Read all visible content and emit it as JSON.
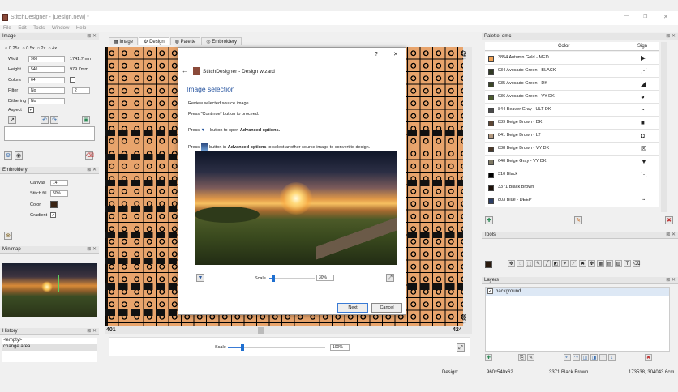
{
  "window": {
    "title": "StitchDesigner - [Design.new] *",
    "minimize": "—",
    "maximize": "❐",
    "close": "✕"
  },
  "menu": [
    "File",
    "Edit",
    "Tools",
    "Window",
    "Help"
  ],
  "image_panel": {
    "title": "Image",
    "zoom_options": [
      "0.25x",
      "0.5x",
      "2x",
      "4x"
    ],
    "width_label": "Width",
    "width_value": "960",
    "width_mm": "1741.7mm",
    "height_label": "Height",
    "height_value": "540",
    "height_mm": "979.7mm",
    "colors_label": "Colors",
    "colors_value": "64",
    "filter_label": "Filter",
    "filter_value": "No",
    "filter_number": "2",
    "dithering_label": "Dithering",
    "dithering_value": "No",
    "aspect_label": "Aspect",
    "aspect_checked": "✓"
  },
  "embroidery_panel": {
    "title": "Embroidery",
    "canvas_label": "Canvas",
    "canvas_value": "14",
    "stitch_label": "Stitch fill",
    "stitch_value": "50%",
    "color_label": "Color",
    "gradient_label": "Gradient",
    "gradient_checked": "✓"
  },
  "minimap_panel": {
    "title": "Minimap"
  },
  "history_panel": {
    "title": "History",
    "items": [
      "<empty>",
      "change area"
    ]
  },
  "tabs": [
    "Image",
    "Design",
    "Palette",
    "Embroidery"
  ],
  "canvas": {
    "ruler_right_top": "167",
    "ruler_right_bottom": "188",
    "ruler_left": "401",
    "ruler_right": "424",
    "scale_label": "Scale",
    "scale_value": "100%",
    "scale_fraction": 0.15
  },
  "dialog": {
    "title": "StitchDesigner - Design wizard",
    "help": "?",
    "close": "✕",
    "back": "←",
    "heading": "Image selection",
    "line1": "Review selected source image.",
    "line2": "Press \"Continue\" button to proceed.",
    "line3_a": "Press",
    "line3_b": "button to open",
    "line3_c": "Advanced options.",
    "line4_a": "Press",
    "line4_b": "button in",
    "line4_c": "Advanced options",
    "line4_d": "to select another source image to convert to design.",
    "scale_label": "Scale",
    "scale_value": "30%",
    "scale_fraction": 0.05,
    "next": "Next",
    "cancel": "Cancel"
  },
  "palette_panel": {
    "title": "Palette: dmc",
    "col_color": "Color",
    "col_sign": "Sign",
    "rows": [
      {
        "name": "3854 Autumn Gold - MED",
        "color": "#f2a456",
        "sign": "▶"
      },
      {
        "name": "934 Avocado Green - BLACK",
        "color": "#313a24",
        "sign": "⋰"
      },
      {
        "name": "935 Avocado Green - DK",
        "color": "#3b4527",
        "sign": "◢"
      },
      {
        "name": "936 Avocado Green - VY DK",
        "color": "#4c5b2e",
        "sign": "◕"
      },
      {
        "name": "844 Beaver Gray - ULT DK",
        "color": "#494949",
        "sign": "◔"
      },
      {
        "name": "839 Beige Brown - DK",
        "color": "#5c4634",
        "sign": "■"
      },
      {
        "name": "841 Beige Brown - LT",
        "color": "#b49a80",
        "sign": "◘"
      },
      {
        "name": "838 Beige Brown - VY DK",
        "color": "#4b3a2a",
        "sign": "☒"
      },
      {
        "name": "640 Beige Gray - VY DK",
        "color": "#7f7a65",
        "sign": "▼"
      },
      {
        "name": "310 Black",
        "color": "#000000",
        "sign": "⋱"
      },
      {
        "name": "3371 Black Brown",
        "color": "#1e1109",
        "sign": ""
      },
      {
        "name": "803 Blue - DEEP",
        "color": "#2c3e66",
        "sign": "⠒"
      }
    ]
  },
  "tools_panel": {
    "title": "Tools"
  },
  "layers_panel": {
    "title": "Layers",
    "layer_name": "background",
    "layer_checked": "✓"
  },
  "status": {
    "design_label": "Design:",
    "size": "960x540x62",
    "color": "3371 Black Brown",
    "coords": "173538, 304043.6cm"
  }
}
